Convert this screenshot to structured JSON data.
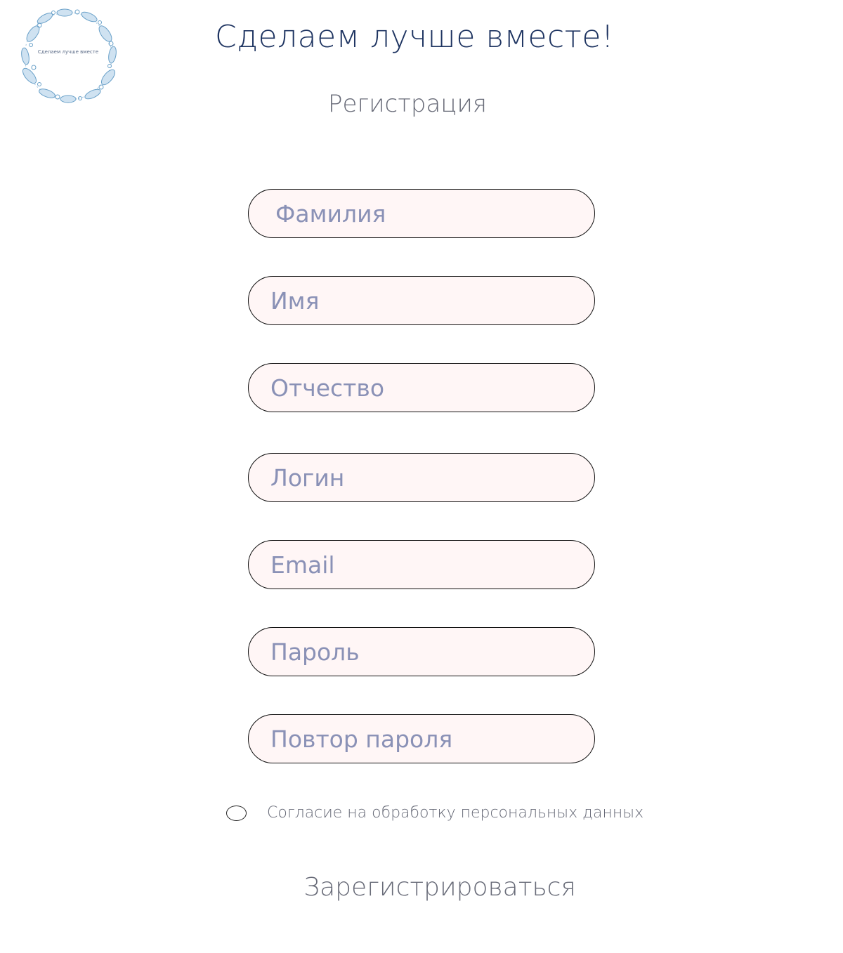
{
  "logo": {
    "text": "Сделаем лучше вместе",
    "icon": "floral-wreath-icon",
    "color": "#6aa1c9"
  },
  "header": {
    "title": "Сделаем лучше вместе!",
    "subtitle": "Регистрация"
  },
  "form": {
    "last_name_placeholder": "Фамилия",
    "first_name_placeholder": "Имя",
    "middle_name_placeholder": "Отчество",
    "login_placeholder": "Логин",
    "email_placeholder": "Email",
    "password_placeholder": "Пароль",
    "password_repeat_placeholder": "Повтор пароля",
    "consent_label": "Согласие на обработку персональных данных",
    "consent_checked": false,
    "submit_label": "Зарегистрироваться"
  },
  "colors": {
    "title": "#1e3461",
    "text": "#686b78",
    "placeholder": "#8a91b6",
    "field_background": "#fff6f6",
    "field_border": "#111111"
  }
}
